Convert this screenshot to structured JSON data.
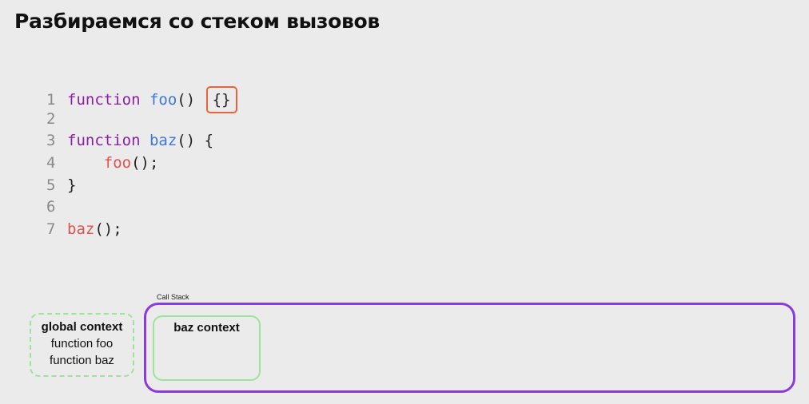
{
  "title": "Разбираемся со стеком вызовов",
  "code": {
    "line_numbers": [
      "1",
      "2",
      "3",
      "4",
      "5",
      "6",
      "7"
    ],
    "line1": {
      "kw": "function",
      "name": "foo",
      "parens": "()",
      "body": "{}"
    },
    "line3": {
      "kw": "function",
      "name": "baz",
      "parens": "()",
      "open": "{"
    },
    "line4": {
      "call": "foo",
      "rest": "();"
    },
    "line5": {
      "close": "}"
    },
    "line7": {
      "call": "baz",
      "rest": "();"
    }
  },
  "call_stack": {
    "label": "Call Stack",
    "frames": [
      {
        "title": "baz context"
      }
    ]
  },
  "global_context": {
    "title": "global context",
    "items": [
      "function foo",
      "function baz"
    ]
  },
  "colors": {
    "keyword": "#8b1fa8",
    "function_name": "#3b78d8",
    "call": "#e0524f",
    "highlight_box": "#e8643c",
    "context_border": "#9ee39a",
    "call_stack_border": "#8a3be0"
  }
}
